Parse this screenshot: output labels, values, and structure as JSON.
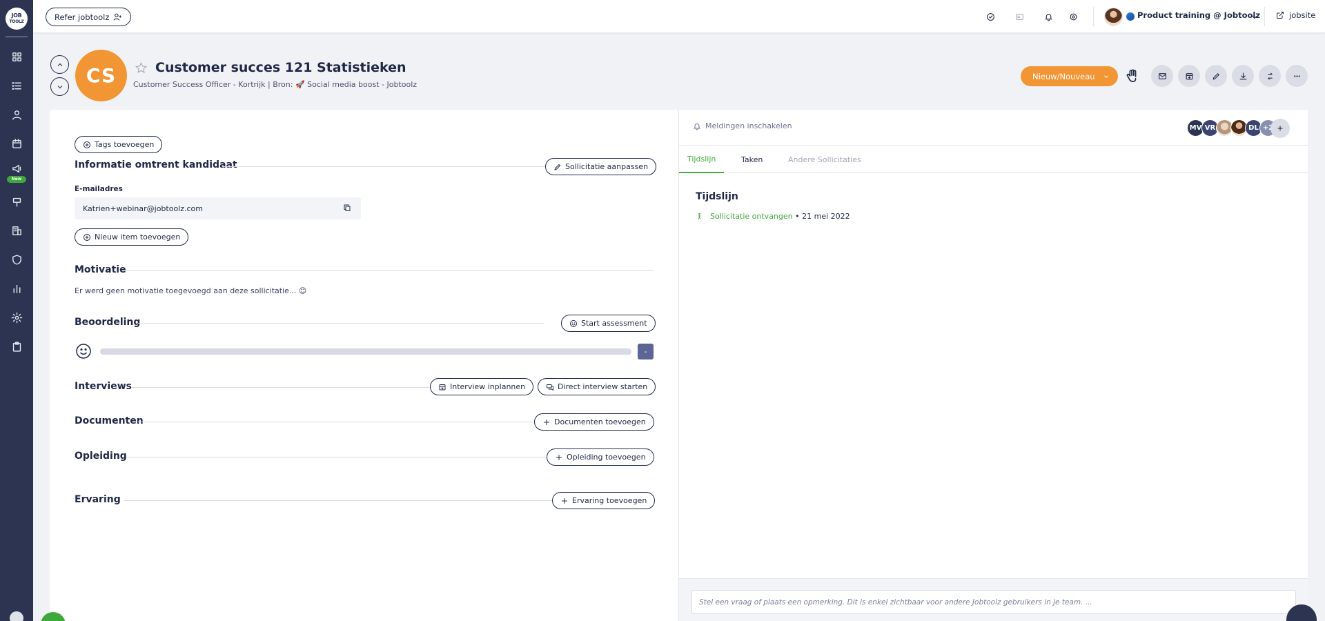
{
  "app": {
    "logo_line1": "JOB",
    "logo_line2": "TOOLZ",
    "new_badge": "New"
  },
  "topbar": {
    "refer_label": "Refer jobtoolz",
    "workspace": "Product training @ Jobtoolz",
    "jobsite_label": "jobsite"
  },
  "header": {
    "initials": "CS",
    "title": "Customer succes 121 Statistieken",
    "subtitle": "Customer Success Officer - Kortrijk | Bron: 🚀 Social media boost - Jobtoolz",
    "new_button": "Nieuw/Nouveau"
  },
  "left": {
    "tags_button": "Tags toevoegen",
    "info_title": "Informatie omtrent kandidaat",
    "edit_application": "Sollicitatie aanpassen",
    "email_label": "E-mailadres",
    "email_value": "Katrien+webinar@jobtoolz.com",
    "new_item": "Nieuw item toevoegen",
    "motivation_title": "Motivatie",
    "motivation_text": "Er werd geen motivatie toegevoegd aan deze sollicitatie... 😊",
    "rating_title": "Beoordeling",
    "start_assessment": "Start assessment",
    "rating_progress": 0,
    "rating_value": "-",
    "interviews_title": "Interviews",
    "plan_interview": "Interview inplannen",
    "direct_interview": "Direct interview starten",
    "documents_title": "Documenten",
    "add_documents": "Documenten toevoegen",
    "education_title": "Opleiding",
    "add_education": "Opleiding toevoegen",
    "experience_title": "Ervaring",
    "add_experience": "Ervaring toevoegen"
  },
  "right": {
    "notifications": "Meldingen inschakelen",
    "members": [
      "MV",
      "VR",
      "DL"
    ],
    "more_members": "+2",
    "tabs": [
      "Tijdslijn",
      "Taken",
      "Andere Sollicitaties"
    ],
    "timeline_title": "Tijdslijn",
    "timeline_event": "Sollicitatie ontvangen",
    "timeline_sep": "•",
    "timeline_date": "21 mei 2022",
    "comment_placeholder": "Stel een vraag of plaats een opmerking. Dit is enkel zichtbaar voor andere Jobtoolz gebruikers in je team. ..."
  },
  "colors": {
    "accent_orange": "#f29535",
    "sidebar": "#2c3451",
    "success_green": "#3ea83a",
    "text_navy": "#1e2745"
  }
}
